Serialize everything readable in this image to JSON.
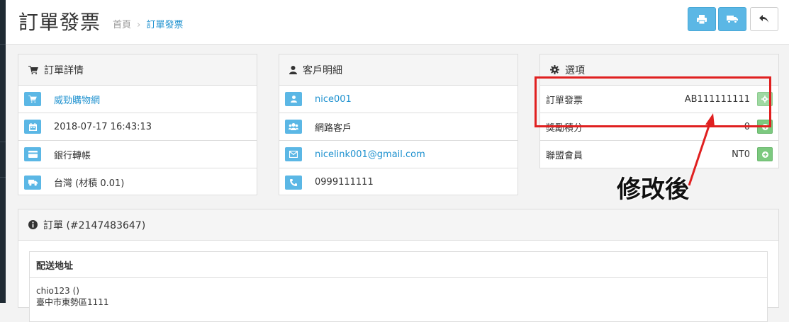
{
  "page": {
    "title": "訂單發票",
    "breadcrumb": {
      "home": "首頁",
      "separator": "›",
      "current": "訂單發票"
    }
  },
  "toolbar": {
    "buttons": [
      {
        "icon": "print-icon"
      },
      {
        "icon": "truck-icon"
      },
      {
        "icon": "reply-icon"
      }
    ]
  },
  "order_details": {
    "title": "訂單詳情",
    "rows": [
      {
        "icon": "cart-icon",
        "text": "威勁購物網",
        "link": true
      },
      {
        "icon": "calendar-icon",
        "text": "2018-07-17 16:43:13",
        "link": false
      },
      {
        "icon": "credit-card-icon",
        "text": "銀行轉帳",
        "link": false
      },
      {
        "icon": "truck-icon",
        "text": "台灣 (材積 0.01)",
        "link": false
      }
    ]
  },
  "customer": {
    "title": "客戶明細",
    "rows": [
      {
        "icon": "user-icon",
        "text": "nice001",
        "link": true
      },
      {
        "icon": "users-icon",
        "text": "網路客戶",
        "link": false
      },
      {
        "icon": "envelope-icon",
        "text": "nicelink001@gmail.com",
        "link": true
      },
      {
        "icon": "phone-icon",
        "text": "0999111111",
        "link": false
      }
    ]
  },
  "options": {
    "title": "選項",
    "rows": [
      {
        "label": "訂單發票",
        "value": "AB111111111",
        "button_icon": "gear-icon"
      },
      {
        "label": "獎勵積分",
        "value": "0",
        "button_icon": "plus-icon"
      },
      {
        "label": "聯盟會員",
        "value": "NT0",
        "button_icon": "plus-icon"
      }
    ]
  },
  "order": {
    "title": "訂單 (#2147483647)",
    "shipping_header": "配送地址",
    "address_lines": [
      "chio123 ()",
      "臺中市東勢區1111"
    ]
  },
  "annotation": {
    "text": "修改後",
    "color": "#e02020"
  },
  "colors": {
    "accent_blue": "#5bb7e5",
    "link_blue": "#1e91cf",
    "green": "#7cc97f"
  }
}
